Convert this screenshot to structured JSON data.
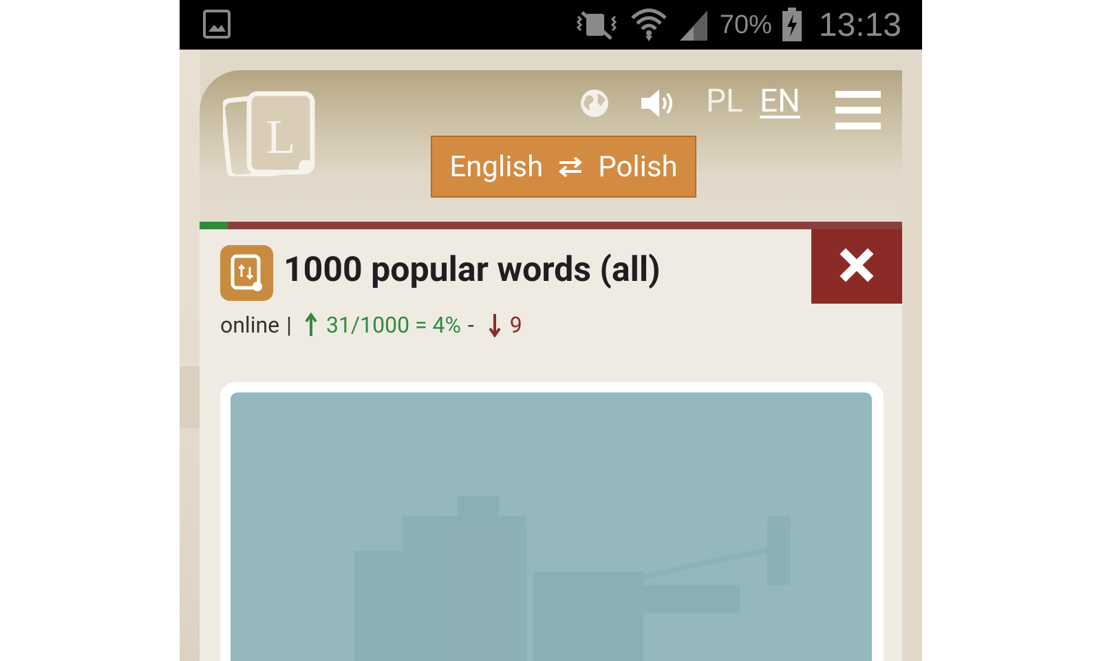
{
  "statusbar": {
    "battery_percent": "70%",
    "time": "13:13",
    "icons": [
      "gallery-icon",
      "vibrate-mute-icon",
      "wifi-icon",
      "signal-icon",
      "battery-charging-icon"
    ]
  },
  "header": {
    "languages": {
      "pl_label": "PL",
      "en_label": "EN",
      "active": "EN"
    },
    "language_pair": {
      "from": "English",
      "to": "Polish"
    },
    "icons": [
      "logo-cards-icon",
      "globe-icon",
      "speaker-icon",
      "hamburger-menu-icon"
    ]
  },
  "progress": {
    "fraction": 0.04,
    "fill_color": "#2e8b3c",
    "track_color": "#8b3f3c"
  },
  "set": {
    "title": "1000 popular words (all)",
    "mode": "online",
    "known_text": "31/1000 = 4%",
    "separator": "-",
    "wrong_count": "9"
  },
  "colors": {
    "accent": "#d38a41",
    "close": "#8b2b27",
    "known": "#2e8b3c"
  }
}
